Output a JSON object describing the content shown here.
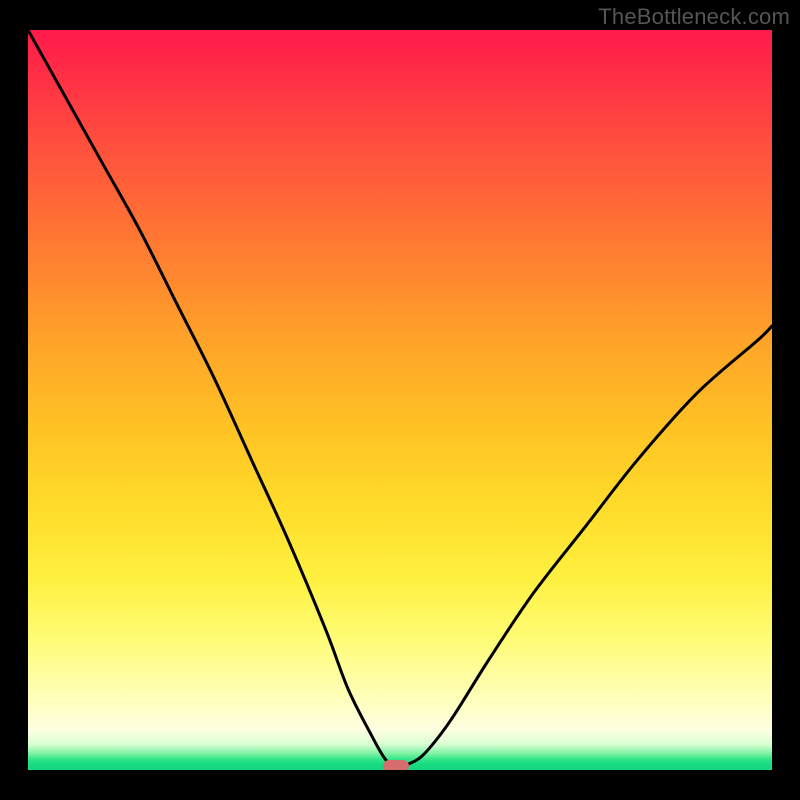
{
  "watermark": "TheBottleneck.com",
  "chart_data": {
    "type": "line",
    "title": "",
    "xlabel": "",
    "ylabel": "",
    "xlim": [
      0,
      100
    ],
    "ylim": [
      0,
      100
    ],
    "grid": false,
    "legend": false,
    "series": [
      {
        "name": "bottleneck-curve",
        "x": [
          0,
          5,
          10,
          15,
          20,
          25,
          30,
          35,
          40,
          43,
          46,
          48,
          49.5,
          52,
          54,
          57,
          62,
          68,
          75,
          82,
          90,
          98,
          100
        ],
        "values": [
          100,
          91,
          82,
          73,
          63,
          53,
          42,
          31,
          19,
          11,
          5,
          1.5,
          0.5,
          1.2,
          3,
          7,
          15,
          24,
          33,
          42,
          51,
          58,
          60
        ]
      }
    ],
    "minimum_marker": {
      "x": 49.5,
      "y": 0.5
    },
    "background_gradient": {
      "top": "#ff1a4b",
      "mid_high": "#ff8a2e",
      "mid": "#ffdb2a",
      "mid_low": "#ffffb8",
      "bottom": "#16d680"
    },
    "colors": {
      "curve": "#000000",
      "marker": "#d66e6b",
      "frame": "#000000",
      "watermark": "#555555"
    }
  }
}
